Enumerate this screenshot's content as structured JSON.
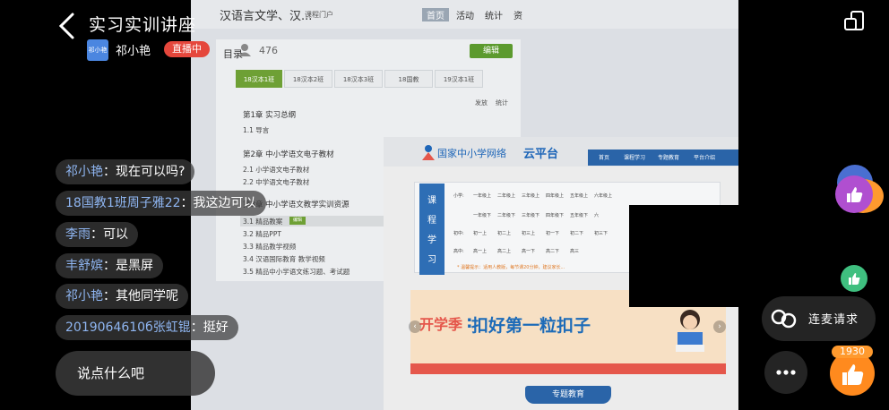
{
  "header": {
    "title": "实习实训讲座",
    "host_avatar_text": "祁小艳",
    "host_name": "祁小艳",
    "live_badge": "直播中"
  },
  "shared_screen": {
    "course_title": "汉语言文学、汉...",
    "course_sub": "课程门户",
    "nav": [
      "首页",
      "活动",
      "统计",
      "资"
    ],
    "catalog_label": "目录",
    "count": "476",
    "edit_label": "编辑",
    "tabs": [
      "18汉本1班",
      "18汉本2班",
      "18汉本3班",
      "18国教",
      "19汉本1班"
    ],
    "toolbar": [
      "发放",
      "统计"
    ],
    "chapter1": "第1章 实习总纲",
    "ch1_items": [
      "1.1 导言"
    ],
    "chapter2": "第2章 中小学语文电子教材",
    "ch2_items": [
      "2.1 小学语文电子教材",
      "2.2 中学语文电子教材"
    ],
    "chapter3": "第3章 中小学语文教学实训资源",
    "ch3_items": [
      "3.1 精品教案",
      "3.2 精品PPT",
      "3.3 精品教学视频",
      "3.4 汉语国际教育 教学视频",
      "3.5 精品中小学语文练习题、考试题"
    ],
    "tag": "编辑"
  },
  "portal": {
    "logo_text": "国家中小学网络",
    "logo_brand": "云平台",
    "nav": [
      "首页",
      "课程学习",
      "专题教育",
      "平台介绍"
    ],
    "vertical_label": [
      "课",
      "程",
      "学",
      "习"
    ],
    "grid_rows": [
      {
        "label": "小学:",
        "cells": [
          "一年级上",
          "二年级上",
          "三年级上",
          "四年级上",
          "五年级上",
          "六年级上"
        ]
      },
      {
        "label": "",
        "cells": [
          "一年级下",
          "二年级下",
          "三年级下",
          "四年级下",
          "五年级下",
          "六"
        ]
      },
      {
        "label": "初中:",
        "cells": [
          "初一上",
          "初二上",
          "初三上",
          "初一下",
          "初二下",
          "初三下"
        ]
      },
      {
        "label": "高中:",
        "cells": [
          "高一上",
          "高二上",
          "高一下",
          "高二下",
          "高三"
        ]
      }
    ],
    "grid_note": "* 温馨提示：适用人教版，每节课20分钟，建议家长...",
    "banner_brand": "开学季",
    "banner_text": "扣好第一粒扣子",
    "feature_label": "专题教育"
  },
  "chat": [
    {
      "nick": "祁小艳",
      "msg": "现在可以吗?"
    },
    {
      "nick": "18国教1班周子雅22",
      "msg": "我这边可以"
    },
    {
      "nick": "李雨",
      "msg": "可以"
    },
    {
      "nick": "丰舒嫔",
      "msg": "是黑屏"
    },
    {
      "nick": "祁小艳",
      "msg": "其他同学呢"
    },
    {
      "nick": "2019064610б张虹锟",
      "msg": "挺好"
    }
  ],
  "input_placeholder": "说点什么吧",
  "mic_label": "连麦请求",
  "like_count": "1930",
  "colors": {
    "accent": "#ff8a1e",
    "live_red": "#e5473c",
    "nick_blue": "#8fb6f2"
  },
  "icons": [
    "back-chevron-icon",
    "screen-switch-icon",
    "mic-link-icon",
    "more-icon",
    "thumb-up-icon"
  ]
}
